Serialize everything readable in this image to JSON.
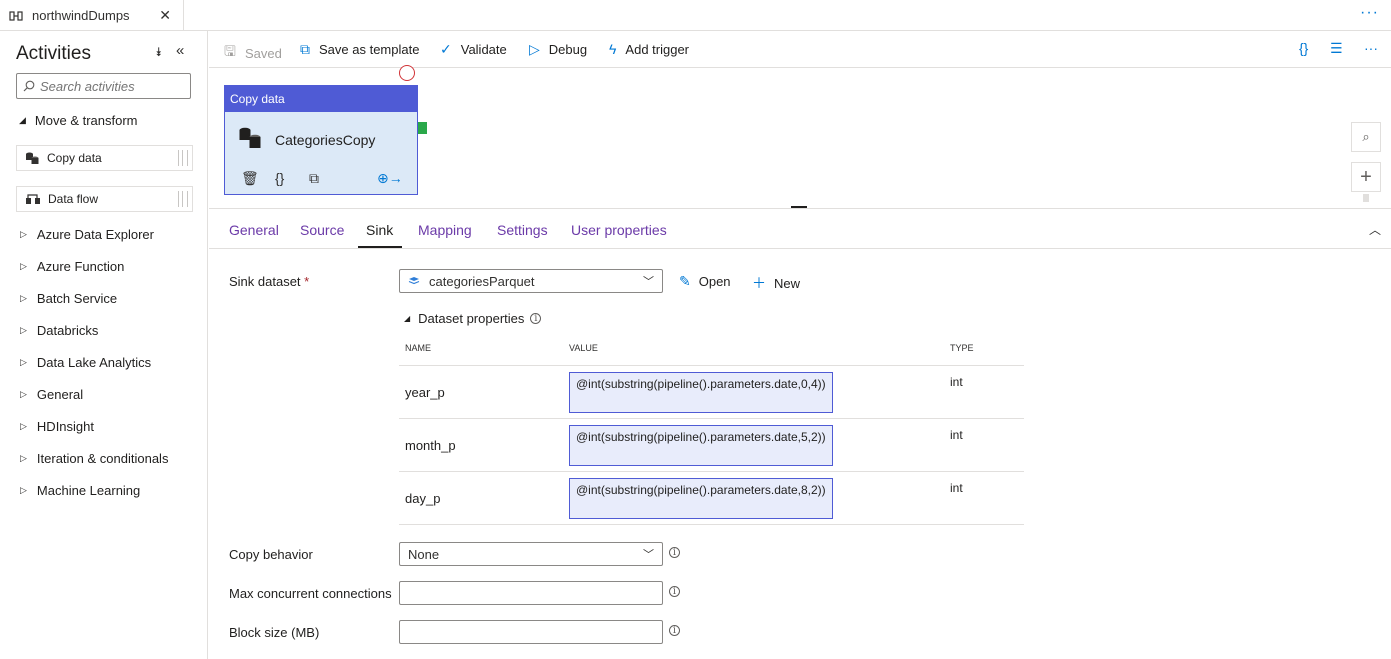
{
  "tab": {
    "title": "northwindDumps",
    "close": "✕",
    "more": "···"
  },
  "activities": {
    "title": "Activities",
    "search_placeholder": "Search activities",
    "section_open": "Move & transform",
    "items": [
      {
        "label": "Copy data",
        "icon": "copy-data-icon"
      },
      {
        "label": "Data flow",
        "icon": "data-flow-icon"
      }
    ],
    "categories": [
      "Azure Data Explorer",
      "Azure Function",
      "Batch Service",
      "Databricks",
      "Data Lake Analytics",
      "General",
      "HDInsight",
      "Iteration & conditionals",
      "Machine Learning"
    ]
  },
  "toolbar": {
    "saved": "Saved",
    "save_as_template": "Save as template",
    "validate": "Validate",
    "debug": "Debug",
    "add_trigger": "Add trigger"
  },
  "canvas": {
    "node_type": "Copy data",
    "node_name": "CategoriesCopy"
  },
  "props": {
    "tabs": [
      "General",
      "Source",
      "Sink",
      "Mapping",
      "Settings",
      "User properties"
    ],
    "active_tab": "Sink",
    "sink_dataset_label": "Sink dataset",
    "required_mark": "*",
    "sink_dataset_value": "categoriesParquet",
    "open_label": "Open",
    "new_label": "New",
    "dataset_properties_label": "Dataset properties",
    "columns": {
      "name": "NAME",
      "value": "VALUE",
      "type": "TYPE"
    },
    "rows": [
      {
        "name": "year_p",
        "value": "@int(substring(pipeline().parameters.date,0,4))",
        "type": "int"
      },
      {
        "name": "month_p",
        "value": "@int(substring(pipeline().parameters.date,5,2))",
        "type": "int"
      },
      {
        "name": "day_p",
        "value": "@int(substring(pipeline().parameters.date,8,2))",
        "type": "int"
      }
    ],
    "copy_behavior_label": "Copy behavior",
    "copy_behavior_value": "None",
    "max_conn_label": "Max concurrent connections",
    "max_conn_value": "",
    "block_size_label": "Block size (MB)",
    "block_size_value": ""
  },
  "colors": {
    "accent": "#0078d4",
    "node_header": "#4f5bd5",
    "node_body": "#dce9f7",
    "link_tab": "#6b3aa8"
  }
}
